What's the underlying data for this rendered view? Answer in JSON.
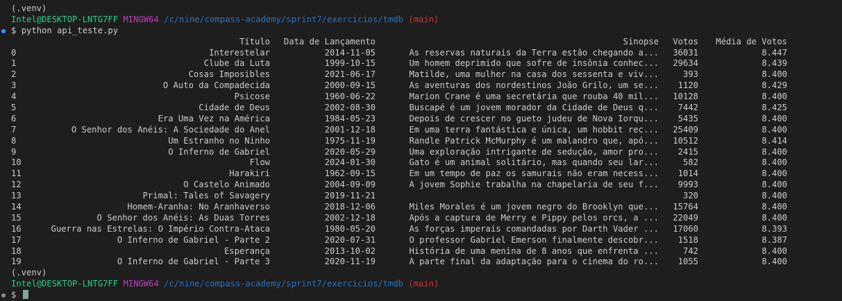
{
  "terminal": {
    "venv_label": "(.venv)",
    "prompt": {
      "user_host": "Intel@DESKTOP-LNTG7FF",
      "shell": "MINGW64",
      "path": "/c/nine/compass-academy/sprint7/exercicios/tmdb",
      "branch": "(main)"
    },
    "prompt_symbol": "$",
    "command": "python api_teste.py"
  },
  "table": {
    "headers": {
      "title": "Título",
      "date": "Data de Lançamento",
      "synopsis": "Sinopse",
      "votes": "Votos",
      "avg": "Média de Votos"
    },
    "rows": [
      {
        "idx": "0",
        "title": "Interestelar",
        "date": "2014-11-05",
        "synopsis": "As reservas naturais da Terra estão chegando a...",
        "votes": "36031",
        "avg": "8.447"
      },
      {
        "idx": "1",
        "title": "Clube da Luta",
        "date": "1999-10-15",
        "synopsis": "Um homem deprimido que sofre de insônia conhec...",
        "votes": "29634",
        "avg": "8.439"
      },
      {
        "idx": "2",
        "title": "Cosas Imposibles",
        "date": "2021-06-17",
        "synopsis": "Matilde, uma mulher na casa dos sessenta e viv...",
        "votes": "393",
        "avg": "8.400"
      },
      {
        "idx": "3",
        "title": "O Auto da Compadecida",
        "date": "2000-09-15",
        "synopsis": "As aventuras dos nordestinos João Grilo, um se...",
        "votes": "1120",
        "avg": "8.429"
      },
      {
        "idx": "4",
        "title": "Psicose",
        "date": "1960-06-22",
        "synopsis": "Marion Crane é uma secretária que rouba 40 mil...",
        "votes": "10128",
        "avg": "8.400"
      },
      {
        "idx": "5",
        "title": "Cidade de Deus",
        "date": "2002-08-30",
        "synopsis": "Buscapé é um jovem morador da Cidade de Deus q...",
        "votes": "7442",
        "avg": "8.425"
      },
      {
        "idx": "6",
        "title": "Era Uma Vez na América",
        "date": "1984-05-23",
        "synopsis": "Depois de crescer no gueto judeu de Nova Iorqu...",
        "votes": "5435",
        "avg": "8.400"
      },
      {
        "idx": "7",
        "title": "O Senhor dos Anéis: A Sociedade do Anel",
        "date": "2001-12-18",
        "synopsis": "Em uma terra fantástica e única, um hobbit rec...",
        "votes": "25409",
        "avg": "8.400"
      },
      {
        "idx": "8",
        "title": "Um Estranho no Ninho",
        "date": "1975-11-19",
        "synopsis": "Randle Patrick McMurphy é um malandro que, apó...",
        "votes": "10512",
        "avg": "8.414"
      },
      {
        "idx": "9",
        "title": "O Inferno de Gabriel",
        "date": "2020-05-29",
        "synopsis": "Uma exploração intrigante de sedução, amor pro...",
        "votes": "2415",
        "avg": "8.400"
      },
      {
        "idx": "10",
        "title": "Flow",
        "date": "2024-01-30",
        "synopsis": "Gato é um animal solitário, mas quando seu lar...",
        "votes": "582",
        "avg": "8.400"
      },
      {
        "idx": "11",
        "title": "Harakiri",
        "date": "1962-09-15",
        "synopsis": "Em um tempo de paz os samurais não eram necess...",
        "votes": "1014",
        "avg": "8.400"
      },
      {
        "idx": "12",
        "title": "O Castelo Animado",
        "date": "2004-09-09",
        "synopsis": "A jovem Sophie trabalha na chapelaria de seu f...",
        "votes": "9993",
        "avg": "8.400"
      },
      {
        "idx": "13",
        "title": "Primal: Tales of Savagery",
        "date": "2019-11-21",
        "synopsis": "",
        "votes": "320",
        "avg": "8.400"
      },
      {
        "idx": "14",
        "title": "Homem-Aranha: No Aranhaverso",
        "date": "2018-12-06",
        "synopsis": "Miles Morales é um jovem negro do Brooklyn que...",
        "votes": "15764",
        "avg": "8.400"
      },
      {
        "idx": "15",
        "title": "O Senhor dos Anéis: As Duas Torres",
        "date": "2002-12-18",
        "synopsis": "Após a captura de Merry e Pippy pelos orcs, a ...",
        "votes": "22049",
        "avg": "8.400"
      },
      {
        "idx": "16",
        "title": "Guerra nas Estrelas: O Império Contra-Ataca",
        "date": "1980-05-20",
        "synopsis": "As forças imperais comandadas por Darth Vader ...",
        "votes": "17060",
        "avg": "8.393"
      },
      {
        "idx": "17",
        "title": "O Inferno de Gabriel - Parte 2",
        "date": "2020-07-31",
        "synopsis": "O professor Gabriel Emerson finalmente descobr...",
        "votes": "1518",
        "avg": "8.387"
      },
      {
        "idx": "18",
        "title": "Esperança",
        "date": "2013-10-02",
        "synopsis": "História de uma menina de 8 anos que enfrenta ...",
        "votes": "742",
        "avg": "8.400"
      },
      {
        "idx": "19",
        "title": "O Inferno de Gabriel - Parte 3",
        "date": "2020-11-19",
        "synopsis": "A parte final da adaptação para o cinema do ro...",
        "votes": "1055",
        "avg": "8.400"
      }
    ]
  },
  "colors": {
    "background": "#1e1e1e",
    "text": "#cccccc",
    "user": "#23d18b",
    "shell": "#bc3fbc",
    "path": "#2472c8",
    "branch": "#cd3131"
  }
}
